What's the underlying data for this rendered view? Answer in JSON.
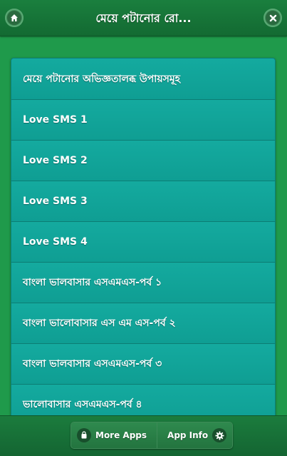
{
  "header": {
    "title": "মেয়ে পটানোর রো...",
    "home_icon": "home-icon",
    "close_icon": "close-icon"
  },
  "list": {
    "items": [
      {
        "label": "মেয়ে পটানোর অভিজ্ঞতালব্ধ উপায়সমূহ"
      },
      {
        "label": "Love SMS 1"
      },
      {
        "label": "Love SMS 2"
      },
      {
        "label": "Love SMS 3"
      },
      {
        "label": "Love SMS 4"
      },
      {
        "label": "বাংলা ভালবাসার এসএমএস-পর্ব ১"
      },
      {
        "label": "বাংলা ভালোবাসার এস এম এস-পর্ব ২"
      },
      {
        "label": "বাংলা ভালবাসার এসএমএস-পর্ব ৩"
      },
      {
        "label": "ভালোবাসার এসএমএস-পর্ব ৪"
      }
    ]
  },
  "footer": {
    "more_apps_label": "More Apps",
    "more_apps_icon": "shopping-bag-icon",
    "app_info_label": "App Info",
    "app_info_icon": "gear-icon"
  },
  "colors": {
    "background": "#1f9a4b",
    "header": "#1a7f3e",
    "list_item": "#11a49a",
    "text": "#ffffff"
  }
}
